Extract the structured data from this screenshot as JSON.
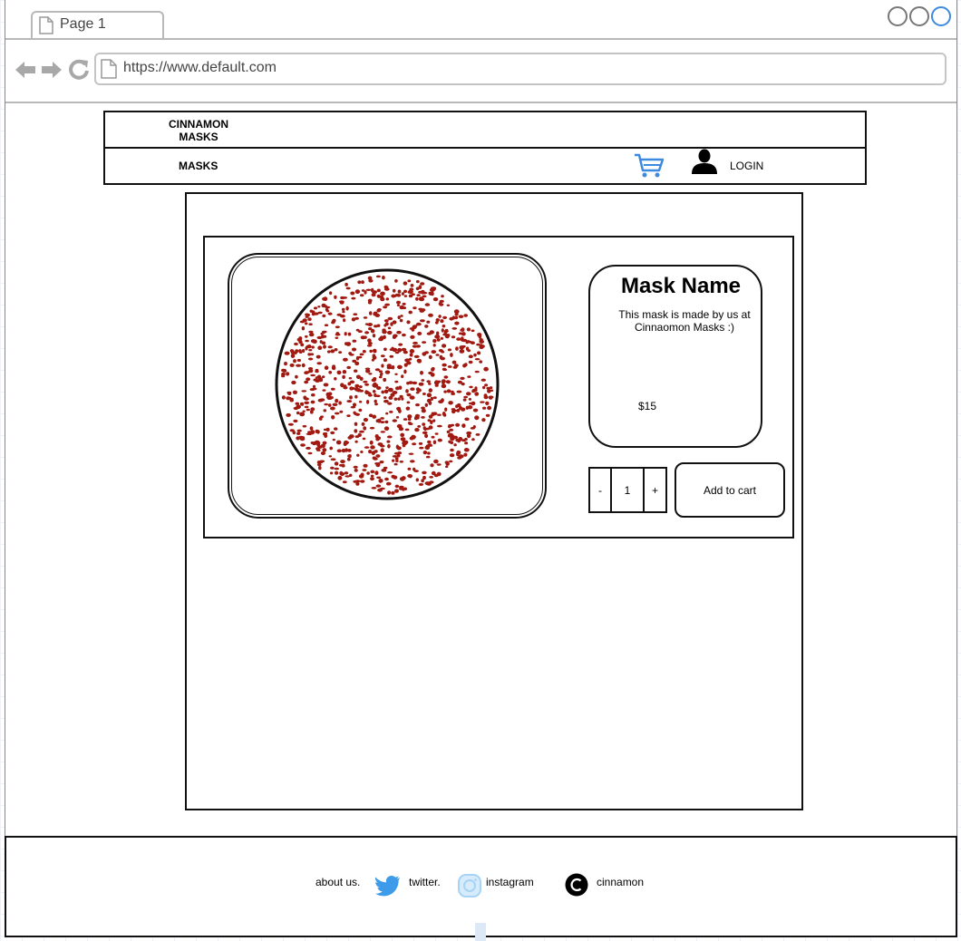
{
  "browser": {
    "tab_title": "Page 1",
    "url": "https://www.default.com"
  },
  "header": {
    "brand_line1": "CINNAMON",
    "brand_line2": "MASKS",
    "nav_masks": "MASKS",
    "login": "LOGIN"
  },
  "product": {
    "name": "Mask Name",
    "description": "This mask is made by us at Cinnaomon Masks :)",
    "price": "$15",
    "qty_minus": "-",
    "qty_value": "1",
    "qty_plus": "+",
    "add_to_cart": "Add to cart"
  },
  "footer": {
    "about": "about us.",
    "twitter": "twitter.",
    "instagram": "instagram",
    "cinnamon": "cinnamon"
  },
  "colors": {
    "cart_icon": "#3d8ae0",
    "twitter_icon": "#3d9be9",
    "instagram_icon": "#a7d3f5",
    "mask_dots": "#a11a12"
  },
  "icons": [
    "document-icon",
    "back-arrow-icon",
    "forward-arrow-icon",
    "reload-icon",
    "cart-icon",
    "user-icon",
    "twitter-icon",
    "instagram-icon",
    "copyright-icon"
  ]
}
